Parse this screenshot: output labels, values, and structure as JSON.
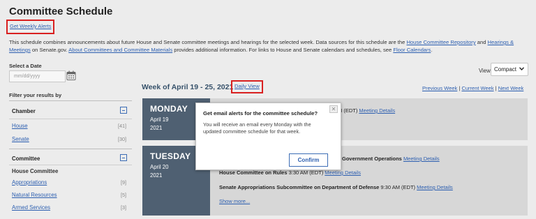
{
  "page_title": "Committee Schedule",
  "weekly_alerts_link": "Get Weekly Alerts",
  "intro": {
    "part1": "This schedule combines announcements about future House and Senate committee meetings and hearings for the selected week. Data sources for this schedule are the ",
    "link1": "House Committee Repository",
    "and": " and ",
    "link2": "Hearings & Meetings",
    "part2": " on Senate.gov. ",
    "link3": "About Committees and Committee Materials",
    "part3": " provides additional information. For links to House and Senate calendars and schedules, see ",
    "link4": "Floor Calendars",
    "end": "."
  },
  "select_date": {
    "label": "Select a Date",
    "placeholder": "mm/dd/yyyy"
  },
  "view": {
    "label": "View",
    "value": "Compact"
  },
  "filters": {
    "title": "Filter your results by",
    "chamber": {
      "heading": "Chamber",
      "items": [
        {
          "label": "House",
          "count": "[41]"
        },
        {
          "label": "Senate",
          "count": "[30]"
        }
      ]
    },
    "committee": {
      "heading": "Committee",
      "subheading": "House Committee",
      "items": [
        {
          "label": "Appropriations",
          "count": "[9]"
        },
        {
          "label": "Natural Resources",
          "count": "[5]"
        },
        {
          "label": "Armed Services",
          "count": "[3]"
        }
      ]
    }
  },
  "week": {
    "title": "Week of April 19 - 25, 2021",
    "daily_view": "Daily View",
    "nav": {
      "previous": "Previous Week",
      "sep": " | ",
      "current": "Current Week",
      "next": "Next Week"
    }
  },
  "days": [
    {
      "name": "MONDAY",
      "date": "April 19",
      "year": "2021",
      "entries": [
        {
          "time": "M (EDT) ",
          "link": "Meeting Details"
        }
      ]
    },
    {
      "name": "TUESDAY",
      "date": "April 20",
      "year": "2021",
      "entries": [
        {
          "title": "Government Operations ",
          "link": "Meeting Details"
        },
        {
          "title": "House Committee on Rules ",
          "time": "3:30 AM (EDT) ",
          "link": "Meeting Details"
        },
        {
          "title": "Senate Appropriations Subcommittee on Department of Defense",
          "time": " 9:30 AM (EDT) ",
          "link": "Meeting Details"
        }
      ],
      "show_more": "Show more..."
    }
  ],
  "modal": {
    "title": "Get email alerts for the committee schedule?",
    "body": "You will receive an email every Monday with the updated committee schedule for that week.",
    "close_glyph": "✕",
    "confirm": "Confirm"
  },
  "colors": {
    "link": "#2d5fb0",
    "day_box": "#4f6072",
    "highlight_border": "#d92020"
  }
}
